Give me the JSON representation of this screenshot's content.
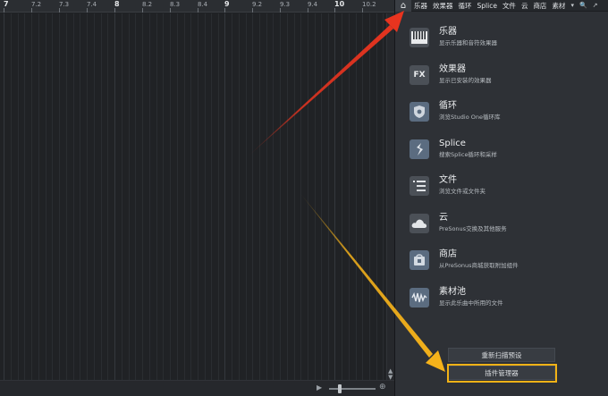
{
  "ruler": {
    "ticks": [
      "7",
      "7.2",
      "7.3",
      "7.4",
      "8",
      "8.2",
      "8.3",
      "8.4",
      "9",
      "9.2",
      "9.3",
      "9.4",
      "10",
      "10.2"
    ],
    "major": [
      "7",
      "8",
      "9",
      "10"
    ]
  },
  "tabs": {
    "home_icon": "home-icon",
    "items": [
      "乐器",
      "效果器",
      "循环",
      "Splice",
      "文件",
      "云",
      "商店",
      "素材"
    ],
    "dropdown_glyph": "▾",
    "search_glyph": "🔍",
    "expand_glyph": "↗"
  },
  "browser": {
    "items": [
      {
        "title": "乐器",
        "sub": "显示乐器和音符效果器",
        "icon": "piano-icon"
      },
      {
        "title": "效果器",
        "sub": "显示已安装的效果器",
        "icon": "fx-icon"
      },
      {
        "title": "循环",
        "sub": "浏览Studio One循环库",
        "icon": "loop-shield-icon"
      },
      {
        "title": "Splice",
        "sub": "搜索Splice循环和采样",
        "icon": "splice-icon"
      },
      {
        "title": "文件",
        "sub": "浏览文件或文件夹",
        "icon": "file-list-icon"
      },
      {
        "title": "云",
        "sub": "PreSonus交换及其他服务",
        "icon": "cloud-icon"
      },
      {
        "title": "商店",
        "sub": "从PreSonus商城获取附加组件",
        "icon": "store-icon"
      },
      {
        "title": "素材池",
        "sub": "显示此乐曲中所用的文件",
        "icon": "waveform-icon"
      }
    ],
    "rescan_label": "重新扫描预设",
    "plugin_manager_label": "插件管理器"
  },
  "colors": {
    "red_arrow": "#e8341f",
    "orange_arrow": "#f5b21a",
    "highlight": "#f2b216"
  }
}
